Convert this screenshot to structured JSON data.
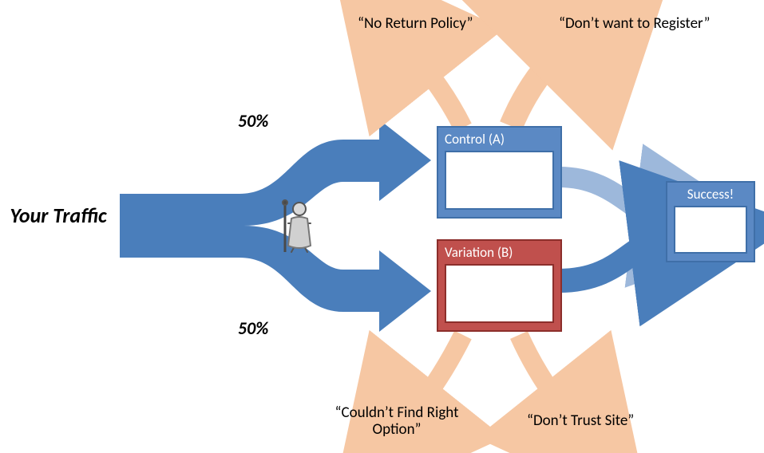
{
  "traffic_label": "Your Traffic",
  "split": {
    "top": "50%",
    "bottom": "50%"
  },
  "control": {
    "title": "Control (A)"
  },
  "variation": {
    "title": "Variation (B)"
  },
  "success": {
    "title": "Success!"
  },
  "dropoffs": {
    "control_left": "“No Return Policy”",
    "control_right": "“Don’t want to Register”",
    "variation_left": "“Couldn’t Find Right Option”",
    "variation_right": "“Don’t Trust Site”"
  },
  "colors": {
    "flow_blue": "#4A7EBB",
    "flow_blue_light": "#9DB8DB",
    "dropoff": "#F6C7A3",
    "control_fill": "#5B89C4",
    "control_stroke": "#3F6FA8",
    "variation_fill": "#C0504D",
    "variation_stroke": "#8C2E2B",
    "success_fill": "#5B89C4",
    "success_stroke": "#3F6FA8"
  }
}
